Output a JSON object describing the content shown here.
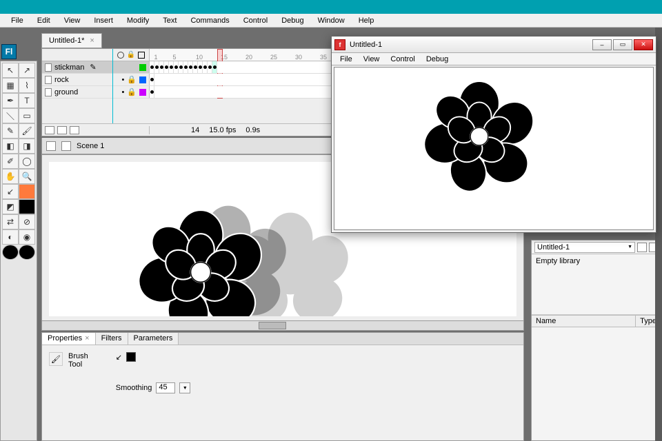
{
  "menu": {
    "items": [
      "File",
      "Edit",
      "View",
      "Insert",
      "Modify",
      "Text",
      "Commands",
      "Control",
      "Debug",
      "Window",
      "Help"
    ]
  },
  "logo": "Fl",
  "doc_tab": {
    "title": "Untitled-1*",
    "close": "×"
  },
  "timeline": {
    "ticks": [
      "1",
      "5",
      "10",
      "15",
      "20",
      "25",
      "30",
      "35"
    ],
    "layers": [
      {
        "name": "stickman",
        "chip": "chip-green",
        "active": true,
        "keyframed": true
      },
      {
        "name": "rock",
        "chip": "chip-blue",
        "active": false,
        "keyframed": false
      },
      {
        "name": "ground",
        "chip": "chip-mag",
        "active": false,
        "keyframed": false
      }
    ],
    "footer": {
      "frame": "14",
      "fps": "15.0 fps",
      "time": "0.9s"
    }
  },
  "scene": {
    "label": "Scene 1"
  },
  "properties": {
    "tabs": [
      "Properties",
      "Filters",
      "Parameters"
    ],
    "tool_line1": "Brush",
    "tool_line2": "Tool",
    "smoothing_label": "Smoothing",
    "smoothing_value": "45"
  },
  "library": {
    "doc": "Untitled-1",
    "empty": "Empty library",
    "cols": {
      "name": "Name",
      "type": "Type"
    }
  },
  "player": {
    "title": "Untitled-1",
    "min": "–",
    "max": "▭",
    "close": "✕",
    "menu": [
      "File",
      "View",
      "Control",
      "Debug"
    ]
  }
}
